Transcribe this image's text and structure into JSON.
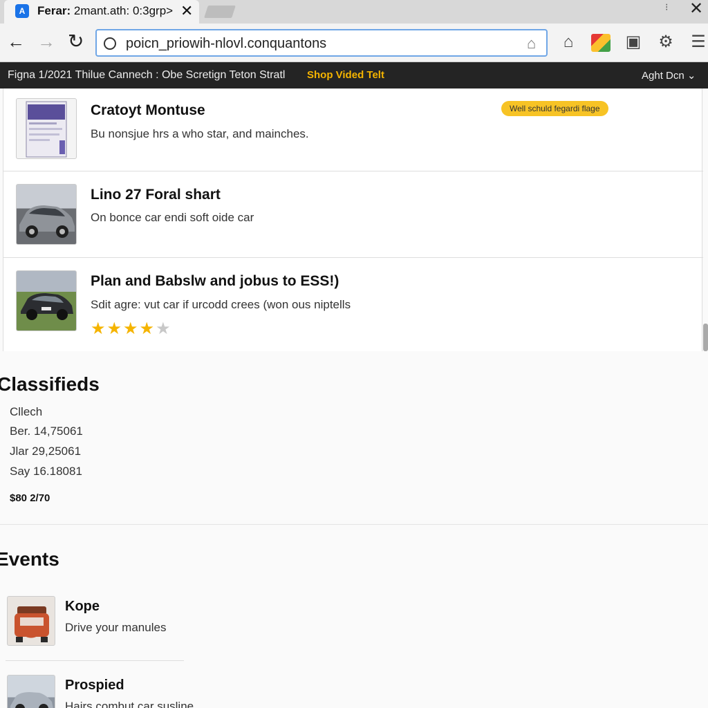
{
  "browser": {
    "tab": {
      "favicon_glyph": "A",
      "title_bold": "Ferar:",
      "title_rest": " 2mant.ath: 0:3grp>",
      "close_glyph": "✕"
    },
    "window_menu_glyph": "⁝",
    "window_close_glyph": "✕",
    "nav": {
      "back_glyph": "←",
      "forward_glyph": "→",
      "reload_glyph": "↻"
    },
    "address_bar": {
      "url": "poicn_priowih-nlovl.conquantons",
      "home_glyph": "⌂"
    },
    "extensions": {
      "home_glyph": "⌂",
      "save_glyph": "▣",
      "settings_glyph": "⚙",
      "menu_glyph": "☰"
    }
  },
  "banner": {
    "text": "Figna 1/2021 Thilue Cannech : Obe Scretign Teton Stratl",
    "link": "Shop Vided Telt",
    "account": "Aght Dcn ⌄"
  },
  "listings": [
    {
      "title": "Cratoyt Montuse",
      "desc": "Bu nonsjue hrs a who star, and mainches.",
      "badge": "Well schuld fegardi flage"
    },
    {
      "title": "Lino 27 Foral shart",
      "desc": "On bonce car endi soft oide car"
    },
    {
      "title": "Plan and Babslw and jobus to ESS!)",
      "desc": "Sdit agre: vut car if urcodd crees (won ous niptells",
      "rating": 4,
      "rating_max": 5
    }
  ],
  "classifieds": {
    "title": "Classifieds",
    "items": [
      "Cllech",
      "Ber. 14,75061",
      "Jlar 29,25061",
      "Say 16.18081"
    ],
    "price": "$80 2/70"
  },
  "events": {
    "title": "Events",
    "items": [
      {
        "title": "Kope",
        "desc": "Drive your manules"
      },
      {
        "title": "Prospied",
        "desc": "Hairs combut car susline"
      }
    ]
  },
  "colors": {
    "accent": "#f5b400",
    "banner_bg": "#242424",
    "omnibox_border": "#6fa6e6"
  }
}
